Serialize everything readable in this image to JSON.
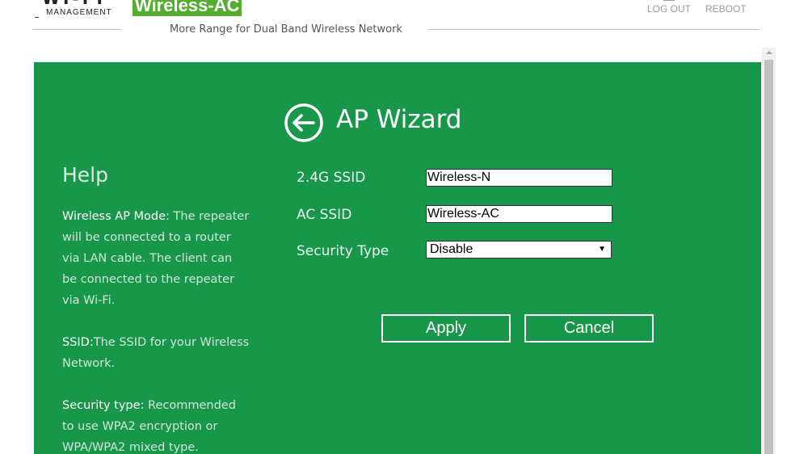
{
  "header": {
    "logo_text": "WI-FI",
    "logo_subtext": "MANAGEMENT",
    "brand": "Wireless-AC",
    "tagline": "More Range for Dual Band Wireless Network",
    "links": {
      "logout": "LOG OUT",
      "reboot": "REBOOT"
    }
  },
  "wizard": {
    "back_icon": "arrow-left-circle-icon",
    "title": "AP Wizard",
    "fields": {
      "ssid_24g": {
        "label": "2.4G SSID",
        "value": "Wireless-N"
      },
      "ac_ssid": {
        "label": "AC SSID",
        "value": "Wireless-AC"
      },
      "security_type": {
        "label": "Security Type",
        "value": "Disable"
      }
    },
    "buttons": {
      "apply": "Apply",
      "cancel": "Cancel"
    }
  },
  "help": {
    "title": "Help",
    "items": [
      {
        "term": "Wireless AP Mode:",
        "text": " The repeater will be connected to a router via LAN cable. The client can be connected to the repeater via Wi-Fi."
      },
      {
        "term": "SSID:",
        "text": "The SSID for your Wireless Network."
      },
      {
        "term": "Security type:",
        "text": " Recommended to use WPA2 encryption or WPA/WPA2 mixed type."
      }
    ]
  },
  "colors": {
    "panel": "#18974b",
    "brand_badge": "#55ad30",
    "text_on_panel": "#ffffff"
  }
}
